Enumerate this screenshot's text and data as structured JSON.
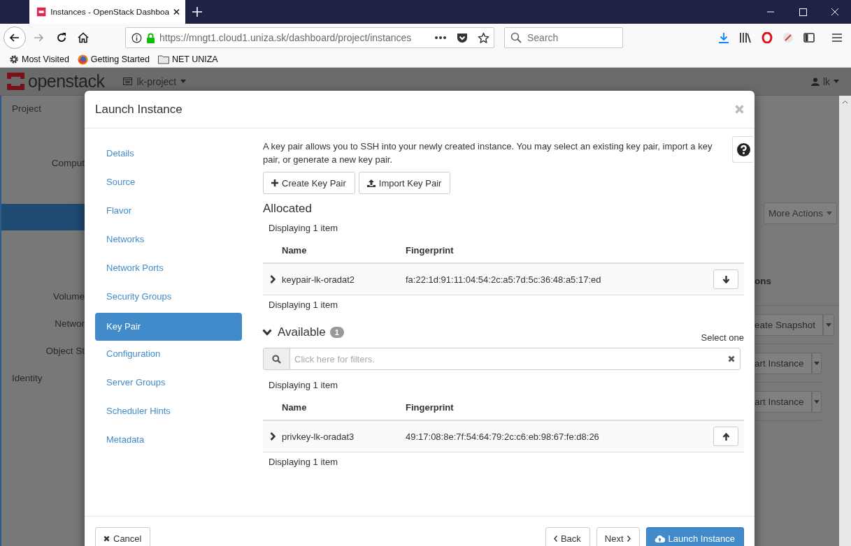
{
  "browser": {
    "tab": {
      "title": "Instances - OpenStack Dashboa",
      "selected": true
    },
    "address": "https://mngt1.cloud1.uniza.sk/dashboard/project/instances",
    "search": {
      "placeholder": "Search"
    },
    "bookmarks": [
      {
        "label": "Most Visited",
        "kind": "gear"
      },
      {
        "label": "Getting Started",
        "kind": "firefox"
      },
      {
        "label": "NET UNIZA",
        "kind": "folder"
      }
    ]
  },
  "dashboard": {
    "logo": "openstack",
    "project": "lk-project",
    "user": "lk",
    "sidebar": [
      {
        "label": "Project",
        "kind": "section"
      },
      {
        "label": "Comput",
        "kind": "group"
      },
      {
        "kind": "active"
      },
      {
        "label": "Volume",
        "kind": "group"
      },
      {
        "label": "Networ",
        "kind": "group"
      },
      {
        "label": "Object St",
        "kind": "group"
      },
      {
        "label": "Identity",
        "kind": "section"
      }
    ],
    "more_actions": "More Actions",
    "column_3": "ons",
    "row_actions": [
      "eate Snapshot",
      "art Instance",
      "art Instance"
    ]
  },
  "modal": {
    "title": "Launch Instance",
    "steps": [
      {
        "label": "Details",
        "selected": false
      },
      {
        "label": "Source",
        "selected": false
      },
      {
        "label": "Flavor",
        "selected": false
      },
      {
        "label": "Networks",
        "selected": false
      },
      {
        "label": "Network Ports",
        "selected": false
      },
      {
        "label": "Security Groups",
        "selected": false
      },
      {
        "label": "Key Pair",
        "selected": true
      },
      {
        "label": "Configuration",
        "selected": false
      },
      {
        "label": "Server Groups",
        "selected": false
      },
      {
        "label": "Scheduler Hints",
        "selected": false
      },
      {
        "label": "Metadata",
        "selected": false
      }
    ],
    "description": "A key pair allows you to SSH into your newly created instance. You may select an existing key pair, import a key pair, or generate a new key pair.",
    "actions": [
      {
        "label": "Create Key Pair",
        "kind": "create"
      },
      {
        "label": "Import Key Pair",
        "kind": "import"
      }
    ],
    "allocated": {
      "heading": "Allocated",
      "count_top": "Displaying 1 item",
      "columns": [
        "Name",
        "Fingerprint"
      ],
      "rows": [
        {
          "name": "keypair-lk-oradat2",
          "fingerprint": "fa:22:1d:91:11:04:54:2c:a5:7d:5c:36:48:a5:17:ed",
          "expanded": false
        }
      ],
      "count_bottom": "Displaying 1 item"
    },
    "available": {
      "heading": "Available",
      "expanded": true,
      "badge": "1",
      "hint": "Select one",
      "filter": {
        "placeholder": "Click here for filters."
      },
      "count_top": "Displaying 1 item",
      "columns": [
        "Name",
        "Fingerprint"
      ],
      "rows": [
        {
          "name": "privkey-lk-oradat3",
          "fingerprint": "49:17:08:8e:7f:54:64:79:2c:c6:eb:98:67:fe:d8:26",
          "expanded": false
        }
      ],
      "count_bottom": "Displaying 1 item"
    },
    "footer": {
      "cancel": "Cancel",
      "back": "Back",
      "next": "Next",
      "launch": "Launch Instance"
    }
  }
}
